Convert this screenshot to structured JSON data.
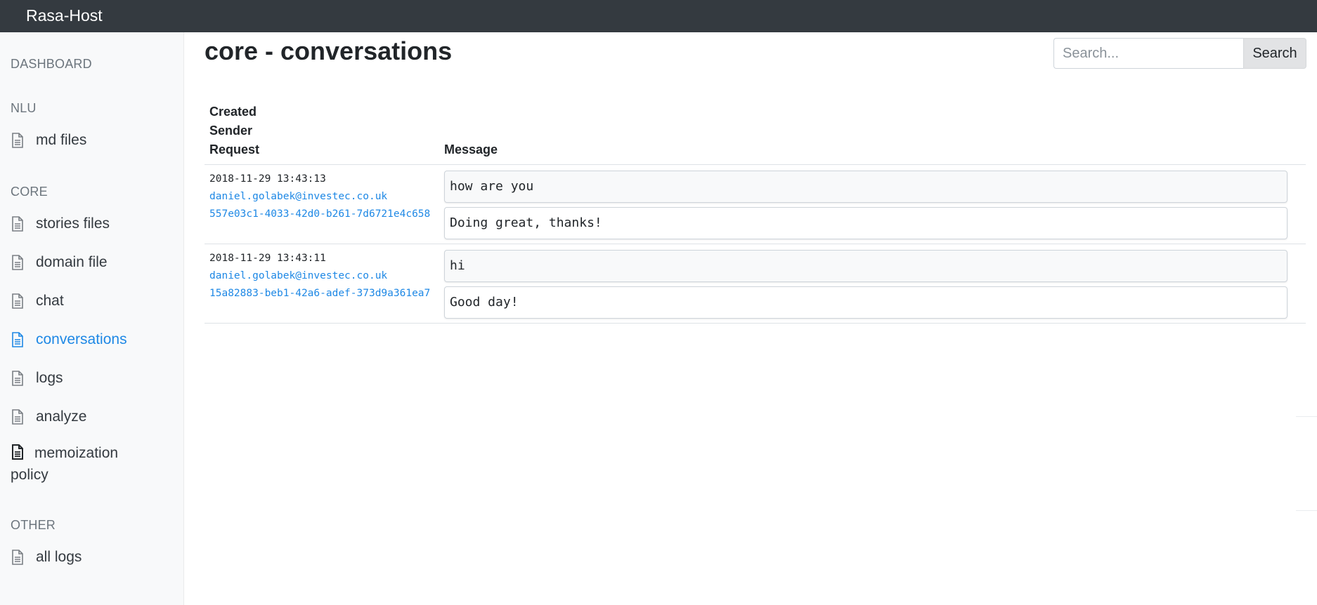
{
  "app": {
    "brand": "Rasa-Host"
  },
  "sidebar": {
    "dashboard": "DASHBOARD",
    "nlu_header": "NLU",
    "nlu_items": [
      {
        "label": "md files",
        "icon": "file-icon"
      }
    ],
    "core_header": "CORE",
    "core_items": [
      {
        "label": "stories files",
        "icon": "file-icon"
      },
      {
        "label": "domain file",
        "icon": "file-icon"
      },
      {
        "label": "chat",
        "icon": "file-icon"
      },
      {
        "label": "conversations",
        "icon": "file-icon",
        "active": true
      },
      {
        "label": "logs",
        "icon": "file-icon"
      },
      {
        "label": "analyze",
        "icon": "file-icon"
      },
      {
        "label": "memoization policy",
        "icon": "file-filled-icon"
      }
    ],
    "other_header": "OTHER",
    "other_items": [
      {
        "label": "all logs",
        "icon": "file-icon"
      }
    ]
  },
  "main": {
    "title": "core - conversations",
    "search": {
      "placeholder": "Search...",
      "button": "Search"
    },
    "table": {
      "headers": {
        "created": "Created",
        "sender": "Sender",
        "request": "Request",
        "message": "Message"
      },
      "rows": [
        {
          "created": "2018-11-29 13:43:13",
          "sender": "daniel.golabek@investec.co.uk",
          "request": "557e03c1-4033-42d0-b261-7d6721e4c658",
          "user_message": "how are you",
          "bot_message": "Doing great, thanks!"
        },
        {
          "created": "2018-11-29 13:43:11",
          "sender": "daniel.golabek@investec.co.uk",
          "request": "15a82883-beb1-42a6-adef-373d9a361ea7",
          "user_message": "hi",
          "bot_message": "Good day!"
        }
      ]
    }
  },
  "colors": {
    "topbar": "#343a40",
    "sidebar": "#f8f9fa",
    "active": "#1e88e5",
    "link": "#1e88e5"
  }
}
